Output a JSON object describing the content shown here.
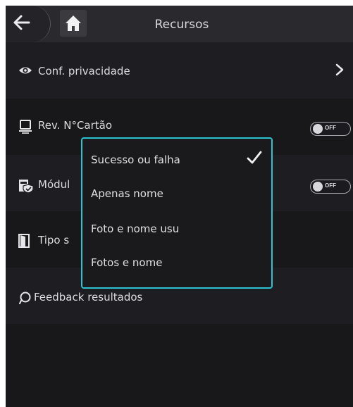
{
  "header": {
    "title": "Recursos",
    "back_icon": "arrow-left-icon",
    "home_icon": "home-icon"
  },
  "rows": [
    {
      "label": "Conf. privacidade",
      "icon": "eye-icon",
      "control": "chevron"
    },
    {
      "label": "Rev. N°Cartão",
      "icon": "card-reader-icon",
      "control": "toggle",
      "state": "OFF"
    },
    {
      "label": "Módul",
      "icon": "module-shield-icon",
      "control": "toggle",
      "state": "OFF"
    },
    {
      "label": "Tipo s",
      "icon": "door-icon",
      "control": "none"
    },
    {
      "label": "Feedback resultados",
      "icon": "feedback-icon",
      "control": "none"
    }
  ],
  "dropdown": {
    "options": [
      "Sucesso ou falha",
      "Apenas nome",
      "Foto e nome usu",
      "Fotos e nome"
    ],
    "selected": "Sucesso ou falha",
    "accent": "#2bc3d1"
  }
}
